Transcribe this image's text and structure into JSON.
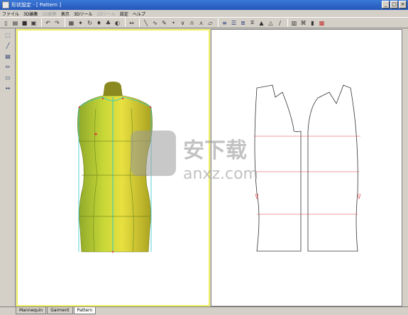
{
  "window": {
    "title": "形状設定 - [ Pattern ]",
    "controls": [
      "_",
      "□",
      "×"
    ]
  },
  "menu": [
    {
      "label": "ファイル",
      "enabled": true
    },
    {
      "label": "3D編集",
      "enabled": true
    },
    {
      "label": "2D編集",
      "enabled": false
    },
    {
      "label": "表示",
      "enabled": true
    },
    {
      "label": "3Dツール",
      "enabled": true
    },
    {
      "label": "2Dツール",
      "enabled": false
    },
    {
      "label": "設定",
      "enabled": true
    },
    {
      "label": "ヘルプ",
      "enabled": true
    }
  ],
  "toolbar_icons": [
    "new-file-icon",
    "open-file-icon",
    "save-icon",
    "save-as-icon",
    "sep",
    "undo-icon",
    "redo-icon",
    "sep",
    "grid-icon",
    "fit-icon",
    "rotate-icon",
    "bodice-icon",
    "garment-icon",
    "render-icon",
    "sep",
    "measure-icon",
    "sep",
    "line-icon",
    "curve-icon",
    "pen-icon",
    "point-icon",
    "dart-icon",
    "fold-icon",
    "seam-icon",
    "eraser-icon",
    "sep",
    "align-left-icon",
    "align-center-icon",
    "align-right-icon",
    "mirror-icon",
    "triangle-icon",
    "outline-triangle-icon",
    "ruler-icon",
    "sep",
    "layout-icon",
    "shirt-icon",
    "bottle-icon",
    "color-icon"
  ],
  "left_tools": [
    "select-icon",
    "brush-icon",
    "layer-icon",
    "pencil-icon",
    "note-icon",
    "split-icon"
  ],
  "tabs": [
    "Mannequin",
    "Garment",
    "Pattern"
  ],
  "active_tab": "Pattern",
  "watermark": {
    "title": "安下载",
    "url": "anxz.com"
  },
  "colors": {
    "titlebar": "#2456b8",
    "mannequin": "#c8d02a",
    "pattern_line": "#333333",
    "guide_red": "#e04040",
    "guide_cyan": "#30c8c8",
    "view_border": "#f0f060"
  }
}
